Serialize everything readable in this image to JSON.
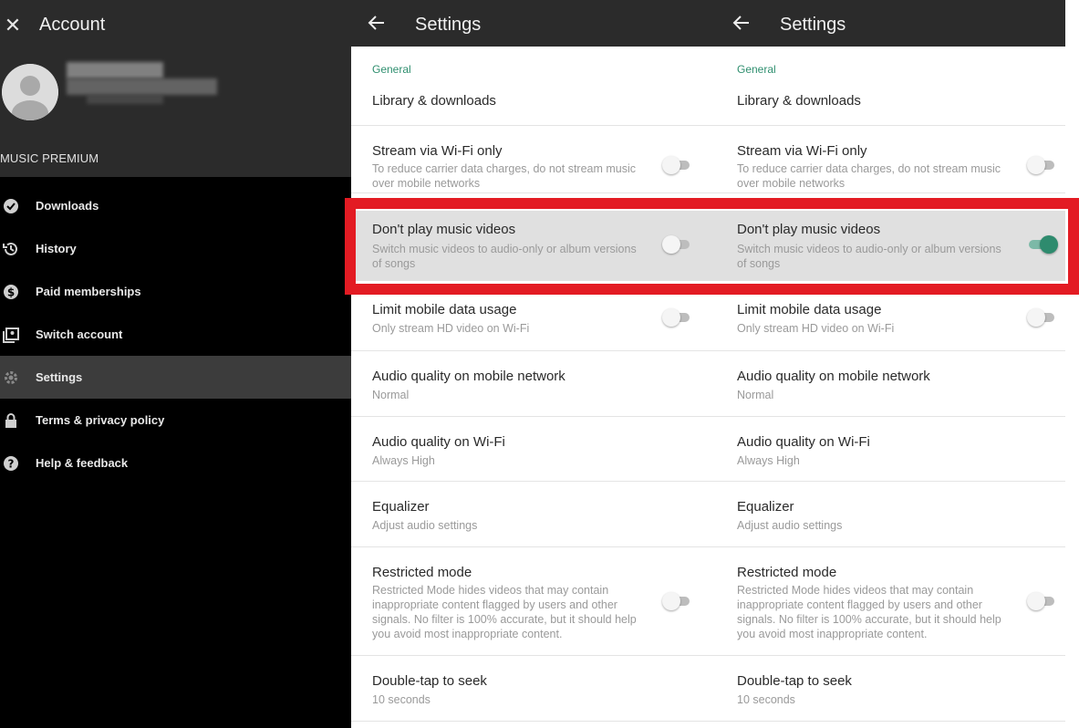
{
  "account": {
    "title": "Account",
    "subscription": "MUSIC PREMIUM",
    "menu": [
      {
        "label": "Downloads",
        "icon": "downloads-icon"
      },
      {
        "label": "History",
        "icon": "history-icon"
      },
      {
        "label": "Paid memberships",
        "icon": "dollar-icon"
      },
      {
        "label": "Switch account",
        "icon": "switch-account-icon"
      },
      {
        "label": "Settings",
        "icon": "gear-icon",
        "active": true
      },
      {
        "label": "Terms & privacy policy",
        "icon": "lock-icon"
      },
      {
        "label": "Help & feedback",
        "icon": "help-icon"
      }
    ]
  },
  "settings_before": {
    "title": "Settings",
    "section": "General",
    "items": [
      {
        "title": "Library & downloads",
        "subtitle": ""
      },
      {
        "title": "Stream via Wi-Fi only",
        "subtitle": "To reduce carrier data charges, do not stream music over mobile networks",
        "toggle": false
      },
      {
        "title": "Don't play music videos",
        "subtitle": "Switch music videos to audio-only or album versions of songs",
        "toggle": false
      },
      {
        "title": "Limit mobile data usage",
        "subtitle": "Only stream HD video on Wi-Fi",
        "toggle": false
      },
      {
        "title": "Audio quality on mobile network",
        "subtitle": "Normal"
      },
      {
        "title": "Audio quality on Wi-Fi",
        "subtitle": "Always High"
      },
      {
        "title": "Equalizer",
        "subtitle": "Adjust audio settings"
      },
      {
        "title": "Restricted mode",
        "subtitle": "Restricted Mode hides videos that may contain inappropriate content flagged by users and other signals. No filter is 100% accurate, but it should help you avoid most inappropriate content.",
        "toggle": false
      },
      {
        "title": "Double-tap to seek",
        "subtitle": "10 seconds"
      }
    ]
  },
  "settings_after": {
    "title": "Settings",
    "section": "General",
    "items": [
      {
        "title": "Library & downloads",
        "subtitle": ""
      },
      {
        "title": "Stream via Wi-Fi only",
        "subtitle": "To reduce carrier data charges, do not stream music over mobile networks",
        "toggle": false
      },
      {
        "title": "Don't play music videos",
        "subtitle": "Switch music videos to audio-only or album versions of songs",
        "toggle": true
      },
      {
        "title": "Limit mobile data usage",
        "subtitle": "Only stream HD video on Wi-Fi",
        "toggle": false
      },
      {
        "title": "Audio quality on mobile network",
        "subtitle": "Normal"
      },
      {
        "title": "Audio quality on Wi-Fi",
        "subtitle": "Always High"
      },
      {
        "title": "Equalizer",
        "subtitle": "Adjust audio settings"
      },
      {
        "title": "Restricted mode",
        "subtitle": "Restricted Mode hides videos that may contain inappropriate content flagged by users and other signals. No filter is 100% accurate, but it should help you avoid most inappropriate content.",
        "toggle": false
      },
      {
        "title": "Double-tap to seek",
        "subtitle": "10 seconds"
      }
    ]
  },
  "colors": {
    "accent": "#2e8b6e",
    "highlight_frame": "#e31b23",
    "header": "#2b2b2b",
    "sidebar": "#000000"
  }
}
